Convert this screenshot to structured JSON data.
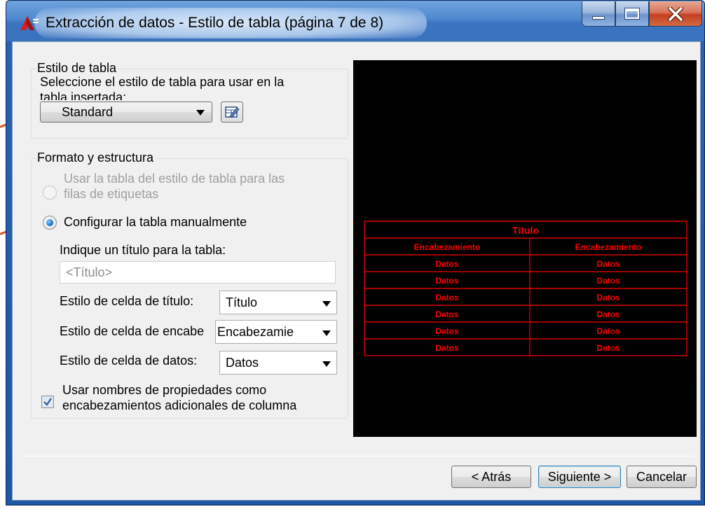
{
  "window": {
    "title": "Extracción de datos - Estilo de tabla (página 7 de 8)"
  },
  "table_style_group": {
    "title": "Estilo de tabla",
    "description_line1": "Seleccione el estilo de tabla para usar en la",
    "description_line2": "tabla insertada:",
    "selected_style": "Standard",
    "edit_icon": "table-style-edit-icon"
  },
  "format_group": {
    "title": "Formato y estructura",
    "option_use_style_line1": "Usar la tabla del estilo de tabla para las",
    "option_use_style_line2": "filas de etiquetas",
    "option_manual": "Configurar la tabla manualmente",
    "title_prompt": "Indique un título para la tabla:",
    "title_placeholder": "<Título>",
    "title_cell_label": "Estilo de celda de título:",
    "title_cell_value": "Título",
    "header_cell_label": "Estilo de celda de encabe",
    "header_cell_value": "Encabezamie",
    "data_cell_label": "Estilo de celda de datos:",
    "data_cell_value": "Datos",
    "use_props_line1": "Usar nombres de propiedades como",
    "use_props_line2": "encabezamientos adicionales de columna",
    "use_props_checked": true,
    "option_manual_selected": true
  },
  "preview": {
    "title": "Título",
    "headers": [
      "Encabezamiento",
      "Encabezamiento"
    ],
    "rows": [
      [
        "Datos",
        "Datos"
      ],
      [
        "Datos",
        "Datos"
      ],
      [
        "Datos",
        "Datos"
      ],
      [
        "Datos",
        "Datos"
      ],
      [
        "Datos",
        "Datos"
      ],
      [
        "Datos",
        "Datos"
      ]
    ],
    "color": "#ff0000"
  },
  "buttons": {
    "back": "< Atrás",
    "next": "Siguiente >",
    "cancel": "Cancelar"
  },
  "colors": {
    "annotation": "#e2571e",
    "titlebar": "#4f88cf",
    "close": "#c43f1e"
  }
}
